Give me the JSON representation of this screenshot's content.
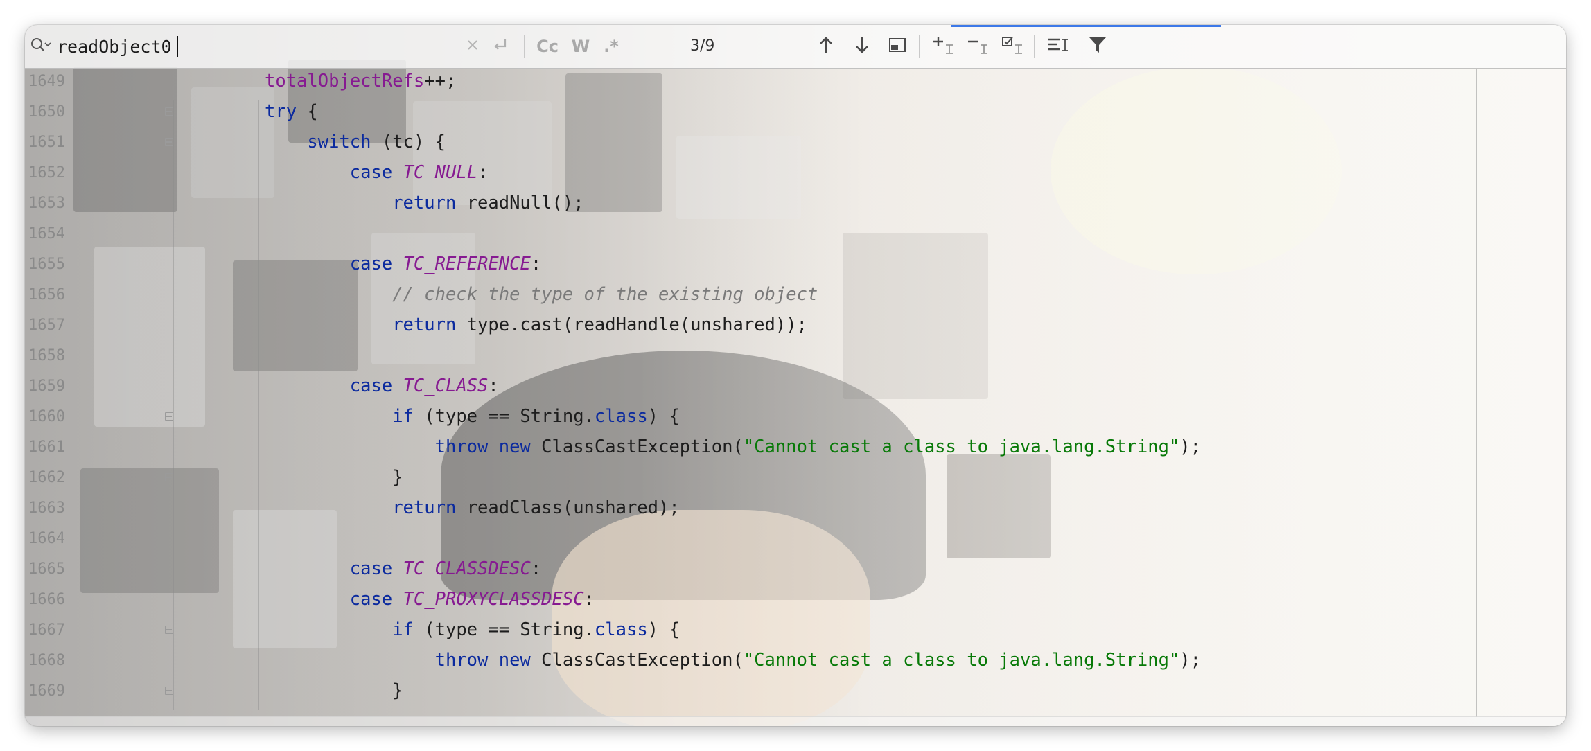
{
  "search": {
    "query": "readObject0",
    "match_counter": "3/9",
    "toggles": {
      "match_case": "Cc",
      "words": "W",
      "regex": ".*"
    },
    "icons": [
      "search-icon",
      "clear-icon",
      "new-line-icon",
      "match-case-icon",
      "whole-words-icon",
      "regex-icon",
      "prev-occurrence-icon",
      "next-occurrence-icon",
      "filter-search-results-icon",
      "add-selection-next-occurrence-icon",
      "remove-selection-icon",
      "select-all-occurrences-icon",
      "toggle-replace-icon",
      "filter-icon"
    ]
  },
  "colors": {
    "keyword": "#0b2a9e",
    "field": "#861a91",
    "string": "#077907",
    "comment": "#7a7a7a",
    "accent": "#3d79e8"
  },
  "code_lines": [
    {
      "num": "1649",
      "indent": 4,
      "tokens": [
        [
          "fld",
          "totalObjectRefs"
        ],
        [
          "",
          "++;"
        ]
      ]
    },
    {
      "num": "1650",
      "indent": 4,
      "fold": true,
      "tokens": [
        [
          "kw",
          "try"
        ],
        [
          "",
          " {"
        ]
      ]
    },
    {
      "num": "1651",
      "indent": 5,
      "fold": true,
      "tokens": [
        [
          "kw",
          "switch"
        ],
        [
          "",
          " (tc) {"
        ]
      ]
    },
    {
      "num": "1652",
      "indent": 6,
      "tokens": [
        [
          "kw",
          "case"
        ],
        [
          "",
          " "
        ],
        [
          "const",
          "TC_NULL"
        ],
        [
          "",
          ":"
        ]
      ]
    },
    {
      "num": "1653",
      "indent": 7,
      "tokens": [
        [
          "kw",
          "return"
        ],
        [
          "",
          " readNull();"
        ]
      ]
    },
    {
      "num": "1654",
      "indent": 0,
      "tokens": []
    },
    {
      "num": "1655",
      "indent": 6,
      "tokens": [
        [
          "kw",
          "case"
        ],
        [
          "",
          " "
        ],
        [
          "const",
          "TC_REFERENCE"
        ],
        [
          "",
          ":"
        ]
      ]
    },
    {
      "num": "1656",
      "indent": 7,
      "tokens": [
        [
          "cmt",
          "// check the type of the existing object"
        ]
      ]
    },
    {
      "num": "1657",
      "indent": 7,
      "tokens": [
        [
          "kw",
          "return"
        ],
        [
          "",
          " type.cast(readHandle(unshared));"
        ]
      ]
    },
    {
      "num": "1658",
      "indent": 0,
      "tokens": []
    },
    {
      "num": "1659",
      "indent": 6,
      "tokens": [
        [
          "kw",
          "case"
        ],
        [
          "",
          " "
        ],
        [
          "const",
          "TC_CLASS"
        ],
        [
          "",
          ":"
        ]
      ]
    },
    {
      "num": "1660",
      "indent": 7,
      "fold": true,
      "tokens": [
        [
          "kw",
          "if"
        ],
        [
          "",
          " (type == String."
        ],
        [
          "kw",
          "class"
        ],
        [
          "",
          ") {"
        ]
      ]
    },
    {
      "num": "1661",
      "indent": 8,
      "tokens": [
        [
          "kw",
          "throw"
        ],
        [
          "",
          " "
        ],
        [
          "kw",
          "new"
        ],
        [
          "",
          " ClassCastException("
        ],
        [
          "str",
          "\"Cannot cast a class to java.lang.String\""
        ],
        [
          "",
          ");"
        ]
      ]
    },
    {
      "num": "1662",
      "indent": 7,
      "fold": true,
      "tokens": [
        [
          "",
          "}"
        ]
      ]
    },
    {
      "num": "1663",
      "indent": 7,
      "tokens": [
        [
          "kw",
          "return"
        ],
        [
          "",
          " readClass(unshared);"
        ]
      ]
    },
    {
      "num": "1664",
      "indent": 0,
      "tokens": []
    },
    {
      "num": "1665",
      "indent": 6,
      "tokens": [
        [
          "kw",
          "case"
        ],
        [
          "",
          " "
        ],
        [
          "const",
          "TC_CLASSDESC"
        ],
        [
          "",
          ":"
        ]
      ]
    },
    {
      "num": "1666",
      "indent": 6,
      "tokens": [
        [
          "kw",
          "case"
        ],
        [
          "",
          " "
        ],
        [
          "const",
          "TC_PROXYCLASSDESC"
        ],
        [
          "",
          ":"
        ]
      ]
    },
    {
      "num": "1667",
      "indent": 7,
      "fold": true,
      "tokens": [
        [
          "kw",
          "if"
        ],
        [
          "",
          " (type == String."
        ],
        [
          "kw",
          "class"
        ],
        [
          "",
          ") {"
        ]
      ]
    },
    {
      "num": "1668",
      "indent": 8,
      "tokens": [
        [
          "kw",
          "throw"
        ],
        [
          "",
          " "
        ],
        [
          "kw",
          "new"
        ],
        [
          "",
          " ClassCastException("
        ],
        [
          "str",
          "\"Cannot cast a class to java.lang.String\""
        ],
        [
          "",
          ");"
        ]
      ]
    },
    {
      "num": "1669",
      "indent": 7,
      "fold": true,
      "tokens": [
        [
          "",
          "}"
        ]
      ]
    }
  ]
}
